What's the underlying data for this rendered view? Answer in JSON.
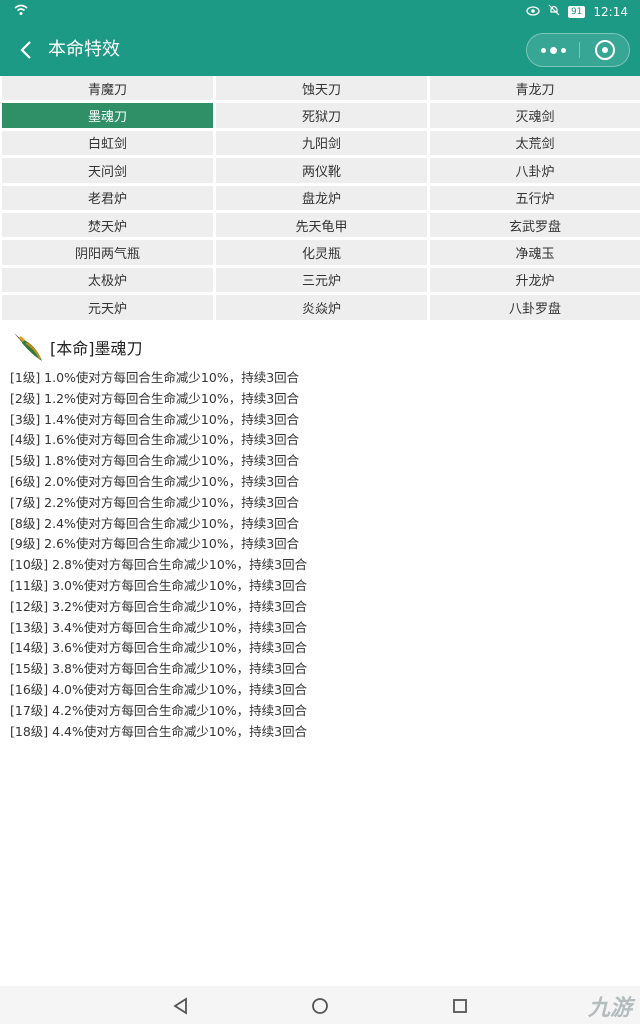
{
  "status_bar": {
    "time": "12:14",
    "battery": "91"
  },
  "header": {
    "back_icon": "chevron-left-icon",
    "title": "本命特效"
  },
  "tabs": [
    "青魔刀",
    "蚀天刀",
    "青龙刀",
    "墨魂刀",
    "死狱刀",
    "灭魂剑",
    "白虹剑",
    "九阳剑",
    "太荒剑",
    "天问剑",
    "两仪靴",
    "八卦炉",
    "老君炉",
    "盘龙炉",
    "五行炉",
    "焚天炉",
    "先天龟甲",
    "玄武罗盘",
    "阴阳两气瓶",
    "化灵瓶",
    "净魂玉",
    "太极炉",
    "三元炉",
    "升龙炉",
    "元天炉",
    "炎焱炉",
    "八卦罗盘"
  ],
  "active_tab": "墨魂刀",
  "colors": {
    "header": "#1c9a86",
    "active_tab": "#2f8f66",
    "tab_bg": "#eeeeee"
  },
  "detail": {
    "icon": "blade-icon",
    "title": "[本命]墨魂刀",
    "effects": [
      "[1级] 1.0%使对方每回合生命减少10%，持续3回合",
      "[2级] 1.2%使对方每回合生命减少10%，持续3回合",
      "[3级] 1.4%使对方每回合生命减少10%，持续3回合",
      "[4级] 1.6%使对方每回合生命减少10%，持续3回合",
      "[5级] 1.8%使对方每回合生命减少10%，持续3回合",
      "[6级] 2.0%使对方每回合生命减少10%，持续3回合",
      "[7级] 2.2%使对方每回合生命减少10%，持续3回合",
      "[8级] 2.4%使对方每回合生命减少10%，持续3回合",
      "[9级] 2.6%使对方每回合生命减少10%，持续3回合",
      "[10级] 2.8%使对方每回合生命减少10%，持续3回合",
      "[11级] 3.0%使对方每回合生命减少10%，持续3回合",
      "[12级] 3.2%使对方每回合生命减少10%，持续3回合",
      "[13级] 3.4%使对方每回合生命减少10%，持续3回合",
      "[14级] 3.6%使对方每回合生命减少10%，持续3回合",
      "[15级] 3.8%使对方每回合生命减少10%，持续3回合",
      "[16级] 4.0%使对方每回合生命减少10%，持续3回合",
      "[17级] 4.2%使对方每回合生命减少10%，持续3回合",
      "[18级] 4.4%使对方每回合生命减少10%，持续3回合"
    ]
  },
  "nav_bar": {
    "back": "triangle-back-icon",
    "home": "circle-home-icon",
    "recent": "square-recent-icon"
  },
  "watermark": "九游"
}
